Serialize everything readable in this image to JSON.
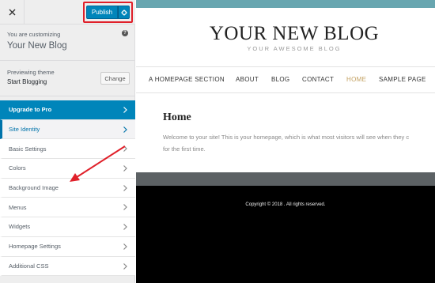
{
  "topbar": {
    "close_icon": "close-icon",
    "publish_label": "Publish",
    "settings_icon": "gear-icon"
  },
  "customizing": {
    "label": "You are customizing",
    "site_name": "Your New Blog",
    "help_icon": "?"
  },
  "theme": {
    "label": "Previewing theme",
    "name": "Start Blogging",
    "change_label": "Change"
  },
  "sidebar": {
    "items": [
      {
        "label": "Upgrade to Pro"
      },
      {
        "label": "Site Identity"
      },
      {
        "label": "Basic Settings"
      },
      {
        "label": "Colors"
      },
      {
        "label": "Background Image"
      },
      {
        "label": "Menus"
      },
      {
        "label": "Widgets"
      },
      {
        "label": "Homepage Settings"
      },
      {
        "label": "Additional CSS"
      }
    ]
  },
  "preview": {
    "blog_title": "YOUR NEW BLOG",
    "tagline": "YOUR AWESOME BLOG",
    "nav": [
      {
        "label": "A HOMEPAGE SECTION"
      },
      {
        "label": "ABOUT"
      },
      {
        "label": "BLOG"
      },
      {
        "label": "CONTACT"
      },
      {
        "label": "HOME"
      },
      {
        "label": "SAMPLE PAGE"
      }
    ],
    "page_title": "Home",
    "page_body_1": "Welcome to your site! This is your homepage, which is what most visitors will see when they c",
    "page_body_2": "for the first time.",
    "copyright": "Copyright © 2018 . All rights reserved."
  },
  "colors": {
    "accent": "#0085ba",
    "highlight_box": "#e0202a",
    "nav_current": "#c3a061",
    "header_bar": "#68a6b0",
    "annotation_arrow": "#e0202a"
  }
}
